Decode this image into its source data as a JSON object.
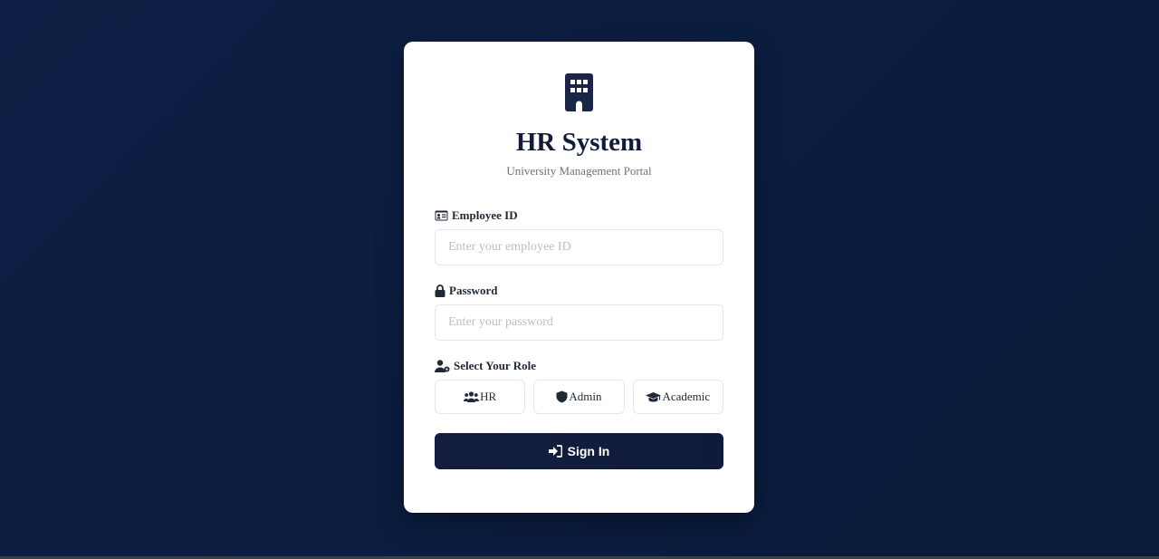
{
  "app": {
    "title": "HR System",
    "subtitle": "University Management Portal",
    "logo_icon": "building-icon"
  },
  "form": {
    "employee_id": {
      "label": "Employee ID",
      "icon": "id-card-icon",
      "value": "",
      "placeholder": "Enter your employee ID"
    },
    "password": {
      "label": "Password",
      "icon": "lock-icon",
      "value": "",
      "placeholder": "Enter your password"
    },
    "role": {
      "label": "Select Your Role",
      "icon": "user-gear-icon",
      "options": [
        {
          "label": "HR",
          "icon": "users-icon"
        },
        {
          "label": "Admin",
          "icon": "shield-icon"
        },
        {
          "label": "Academic",
          "icon": "graduation-cap-icon"
        }
      ]
    },
    "submit": {
      "label": "Sign In",
      "icon": "sign-in-icon"
    }
  },
  "colors": {
    "background": "#0b1d40",
    "primary": "#111c3a",
    "card": "#ffffff",
    "border": "#e2e8f0",
    "muted_text": "#6b7280"
  }
}
